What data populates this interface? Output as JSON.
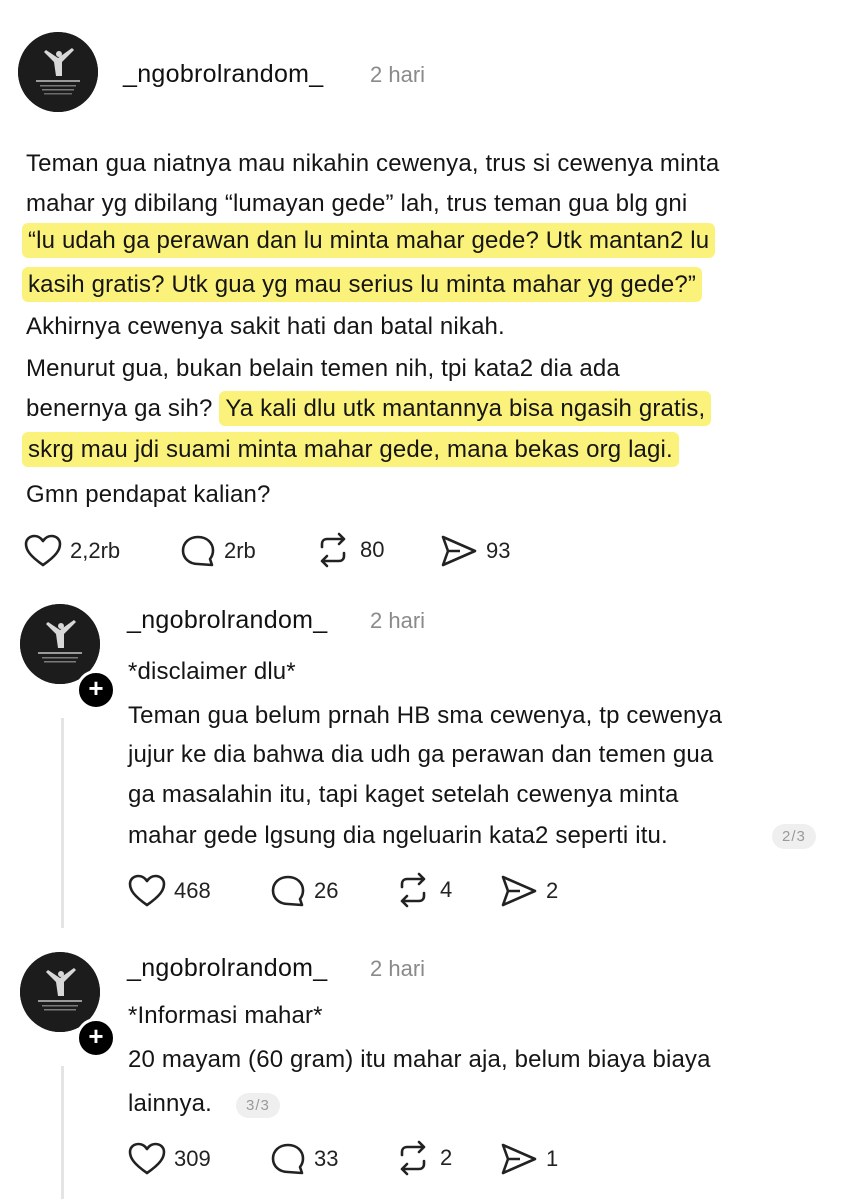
{
  "post": {
    "username": "_ngobrolrandom_",
    "time": "2 hari",
    "lines": [
      "Teman gua niatnya mau nikahin cewenya, trus si cewenya minta",
      "mahar yg dibilang “lumayan gede” lah, trus teman gua blg gni",
      "“lu udah ga perawan dan lu minta mahar gede? Utk mantan2 lu",
      "kasih gratis? Utk gua yg mau serius lu minta mahar yg gede?”",
      "Akhirnya cewenya sakit hati dan batal nikah.",
      "Menurut gua, bukan belain temen nih, tpi kata2 dia ada",
      "benernya ga sih?",
      "Ya kali dlu utk mantannya bisa ngasih gratis,",
      "skrg mau jdi suami minta mahar gede, mana bekas org lagi.",
      "Gmn pendapat kalian?"
    ],
    "likes": "2,2rb",
    "comments": "2rb",
    "reposts": "80",
    "shares": "93"
  },
  "reply1": {
    "username": "_ngobrolrandom_",
    "time": "2 hari",
    "lines": [
      "*disclaimer dlu*",
      "Teman gua belum prnah HB sma cewenya, tp cewenya",
      "jujur ke dia bahwa dia udh ga perawan dan temen gua",
      "ga masalahin itu, tapi kaget setelah cewenya minta",
      "mahar gede lgsung dia ngeluarin kata2 seperti itu."
    ],
    "page": "2/3",
    "likes": "468",
    "comments": "26",
    "reposts": "4",
    "shares": "2"
  },
  "reply2": {
    "username": "_ngobrolrandom_",
    "time": "2 hari",
    "lines": [
      "*Informasi mahar*",
      "20 mayam (60 gram) itu mahar aja, belum biaya biaya",
      "lainnya."
    ],
    "page": "3/3",
    "likes": "309",
    "comments": "33",
    "reposts": "2",
    "shares": "1"
  },
  "colors": {
    "highlight": "#fbf27c",
    "muted": "#8a8a8a"
  },
  "icons": [
    "heart-icon",
    "comment-icon",
    "repost-icon",
    "share-icon",
    "follow-plus-icon"
  ]
}
